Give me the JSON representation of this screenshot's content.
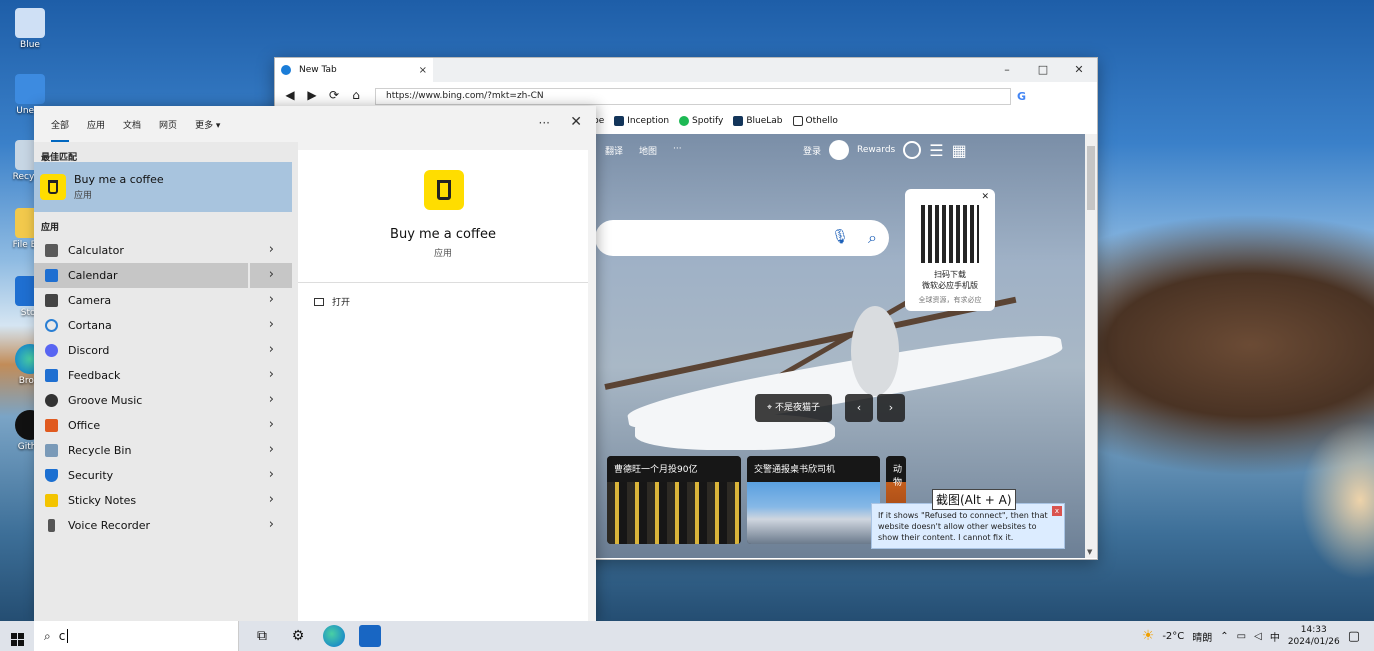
{
  "desktop": {
    "icons": [
      {
        "label": "Blue"
      },
      {
        "label": "Unesc"
      },
      {
        "label": "Recycle"
      },
      {
        "label": "File Exp"
      },
      {
        "label": "Stor"
      },
      {
        "label": "Brow"
      },
      {
        "label": "Githu"
      }
    ]
  },
  "browser": {
    "tab_title": "New Tab",
    "tab_close": "×",
    "window_controls": {
      "minimize": "–",
      "maximize": "□",
      "close": "✕"
    },
    "nav": {
      "back": "◀",
      "forward": "▶",
      "refresh": "⟳",
      "home": "⌂"
    },
    "address": "https://www.bing.com/?mkt=zh-CN",
    "bookmarks": [
      {
        "label": "pe"
      },
      {
        "label": "Inception"
      },
      {
        "label": "Spotify"
      },
      {
        "label": "BlueLab"
      },
      {
        "label": "Othello"
      }
    ],
    "bing": {
      "nav_items": [
        "翻译",
        "地图",
        "···"
      ],
      "login": "登录",
      "rewards": "Rewards",
      "qr_title": "扫码下载",
      "qr_title2": "微软必应手机版",
      "qr_sub": "全球资源，有求必应",
      "location": "不是夜猫子",
      "news": [
        {
          "title": "曹德旺一个月投90亿"
        },
        {
          "title": "交警通报桌书欣司机"
        },
        {
          "title": "动物"
        }
      ],
      "error_tooltip": "If it shows \"Refused to connect\", then that website doesn't allow other websites to show their content. I cannot fix it."
    },
    "screenshot_tip": "截图(Alt + A)"
  },
  "start_panel": {
    "tabs": [
      "全部",
      "应用",
      "文档",
      "网页",
      "更多 ▾"
    ],
    "more_dots": "···",
    "close": "✕",
    "best_match_header": "最佳匹配",
    "best_match": {
      "title": "Buy me a coffee",
      "subtitle": "应用"
    },
    "apps_header": "应用",
    "apps": [
      {
        "label": "Calculator",
        "color": "#5a5a5a"
      },
      {
        "label": "Calendar",
        "color": "#1f6fd1"
      },
      {
        "label": "Camera",
        "color": "#444444"
      },
      {
        "label": "Cortana",
        "color": "#2a7fd4"
      },
      {
        "label": "Discord",
        "color": "#5865f2"
      },
      {
        "label": "Feedback",
        "color": "#1f6fd1"
      },
      {
        "label": "Groove Music",
        "color": "#333333"
      },
      {
        "label": "Office",
        "color": "#e05a1f"
      },
      {
        "label": "Recycle Bin",
        "color": "#7a9ab8"
      },
      {
        "label": "Security",
        "color": "#1b6fd1"
      },
      {
        "label": "Sticky Notes",
        "color": "#f3c400"
      },
      {
        "label": "Voice Recorder",
        "color": "#555555"
      }
    ],
    "detail": {
      "title": "Buy me a coffee",
      "subtitle": "应用",
      "open": "打开"
    }
  },
  "taskbar": {
    "search_value": "c",
    "weather_temp": "-2°C",
    "weather_text": "晴朗",
    "ime": "中",
    "time": "14:33",
    "date": "2024/01/26"
  }
}
